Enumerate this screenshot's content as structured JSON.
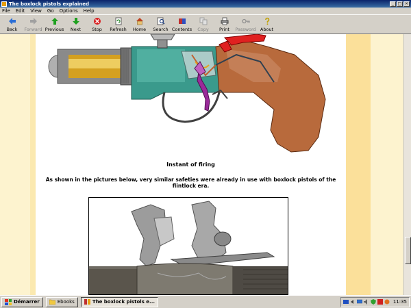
{
  "window": {
    "title": "The boxlock pistols explained",
    "controls": {
      "minimize": "_",
      "maximize": "□",
      "close": "×"
    }
  },
  "menu": [
    "File",
    "Edit",
    "View",
    "Go",
    "Options",
    "Help"
  ],
  "toolbar": {
    "items": [
      {
        "label": "Back",
        "icon": "back-arrow-icon",
        "enabled": true
      },
      {
        "label": "Forward",
        "icon": "forward-arrow-icon",
        "enabled": false
      },
      {
        "label": "Previous",
        "icon": "up-arrow-icon",
        "enabled": true
      },
      {
        "label": "Next",
        "icon": "down-arrow-icon",
        "enabled": true
      },
      {
        "label": "Stop",
        "icon": "stop-icon",
        "enabled": true
      },
      {
        "label": "Refresh",
        "icon": "refresh-icon",
        "enabled": true
      },
      {
        "label": "Home",
        "icon": "home-icon",
        "enabled": true
      },
      {
        "label": "Search",
        "icon": "search-icon",
        "enabled": true
      },
      {
        "label": "Contents",
        "icon": "contents-icon",
        "enabled": true
      },
      {
        "label": "Copy",
        "icon": "copy-icon",
        "enabled": false
      },
      {
        "label": "Print",
        "icon": "print-icon",
        "enabled": true
      },
      {
        "label": "Password",
        "icon": "key-icon",
        "enabled": false
      },
      {
        "label": "About",
        "icon": "question-icon",
        "enabled": true
      }
    ]
  },
  "page": {
    "caption": "Instant of firing",
    "paragraph": "As shown in the pictures below, very similar safeties were already in use with boxlock pistols of the flintlock era."
  },
  "taskbar": {
    "start_label": "Démarrer",
    "tasks": [
      {
        "label": "Ebooks",
        "icon": "folder-icon",
        "active": false
      },
      {
        "label": "The boxlock pistols e...",
        "icon": "help-book-icon",
        "active": true
      }
    ],
    "clock": "11:35"
  },
  "colors": {
    "titlebar": "#0a246a",
    "page_band_left": "#fdf3cf",
    "page_band_right": "#fbe09a",
    "grip_wood": "#b86a3c",
    "frame_teal": "#3a9a8c",
    "trigger_purple": "#9a2a9a",
    "hammer_red": "#e02020"
  }
}
